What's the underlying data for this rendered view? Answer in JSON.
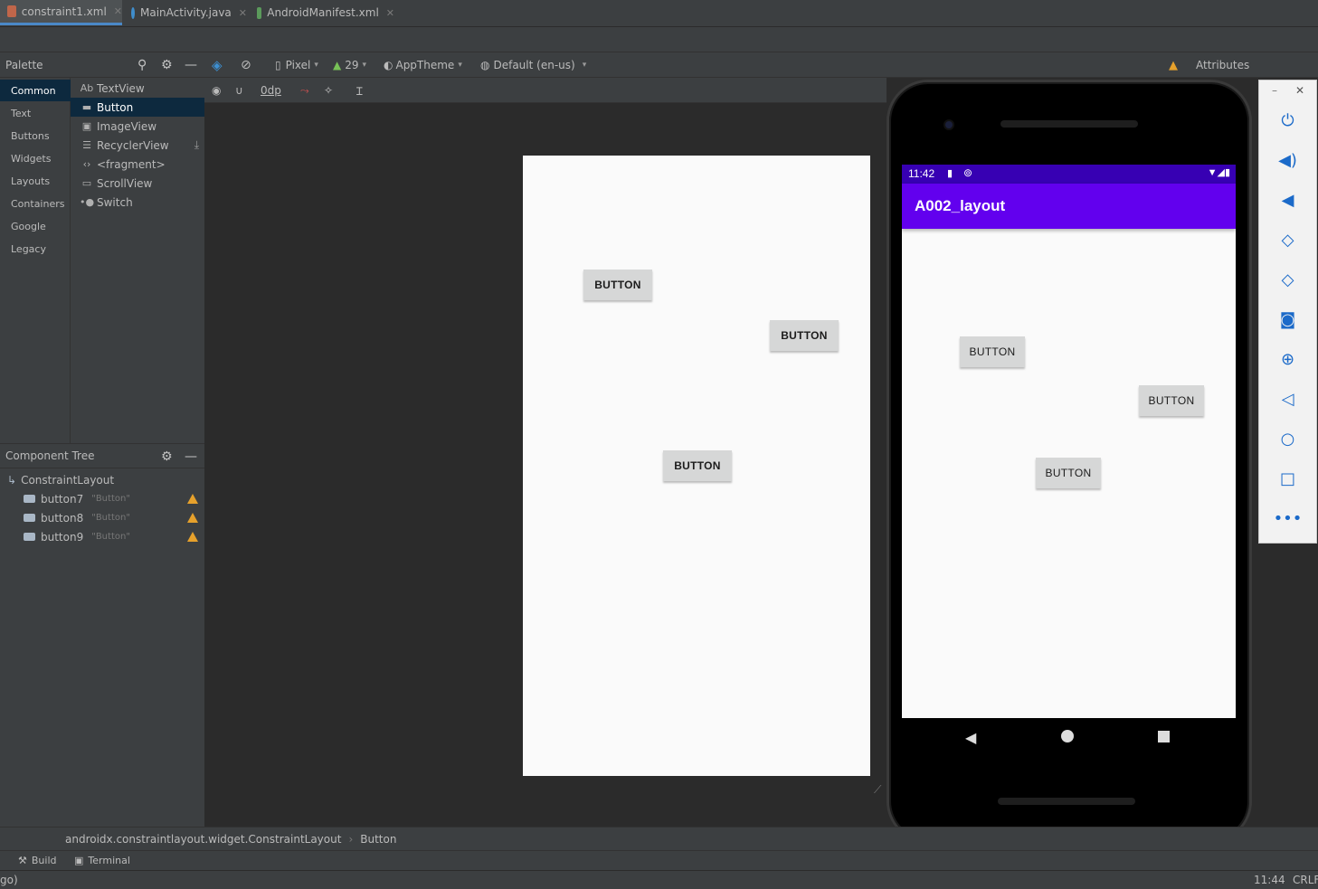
{
  "tabs": [
    {
      "label": "constraint1.xml",
      "icon": "layout-xml-icon",
      "active": true
    },
    {
      "label": "MainActivity.java",
      "icon": "java-class-icon",
      "active": false
    },
    {
      "label": "AndroidManifest.xml",
      "icon": "manifest-icon",
      "active": false
    }
  ],
  "palette": {
    "title": "Palette",
    "categories": [
      "Common",
      "Text",
      "Buttons",
      "Widgets",
      "Layouts",
      "Containers",
      "Google",
      "Legacy"
    ],
    "items": [
      {
        "icon": "Ab",
        "label": "TextView"
      },
      {
        "icon": "button-icon",
        "label": "Button"
      },
      {
        "icon": "image-icon",
        "label": "ImageView"
      },
      {
        "icon": "list-icon",
        "label": "RecyclerView"
      },
      {
        "icon": "code-icon",
        "label": "<fragment>"
      },
      {
        "icon": "scroll-icon",
        "label": "ScrollView"
      },
      {
        "icon": "switch-icon",
        "label": "Switch"
      }
    ]
  },
  "toolbar": {
    "device": "Pixel",
    "api": "29",
    "theme": "AppTheme",
    "locale": "Default (en-us)",
    "margin": "0dp",
    "attributes_label": "Attributes"
  },
  "tree": {
    "title": "Component Tree",
    "root": "ConstraintLayout",
    "children": [
      {
        "id": "button7",
        "text": "\"Button\""
      },
      {
        "id": "button8",
        "text": "\"Button\""
      },
      {
        "id": "button9",
        "text": "\"Button\""
      }
    ]
  },
  "design": {
    "buttons": [
      "BUTTON",
      "BUTTON",
      "BUTTON"
    ]
  },
  "emulator": {
    "time": "11:42",
    "app_title": "A002_layout",
    "buttons": [
      "BUTTON",
      "BUTTON",
      "BUTTON"
    ],
    "app_bar_color": "#6200ee",
    "status_bar_color": "#3700b3"
  },
  "breadcrumb": {
    "path": "androidx.constraintlayout.widget.ConstraintLayout",
    "leaf": "Button"
  },
  "toolwindows": [
    "Build",
    "Terminal"
  ],
  "status": {
    "left": "go)",
    "time": "11:44",
    "line_ending": "CRLF"
  }
}
